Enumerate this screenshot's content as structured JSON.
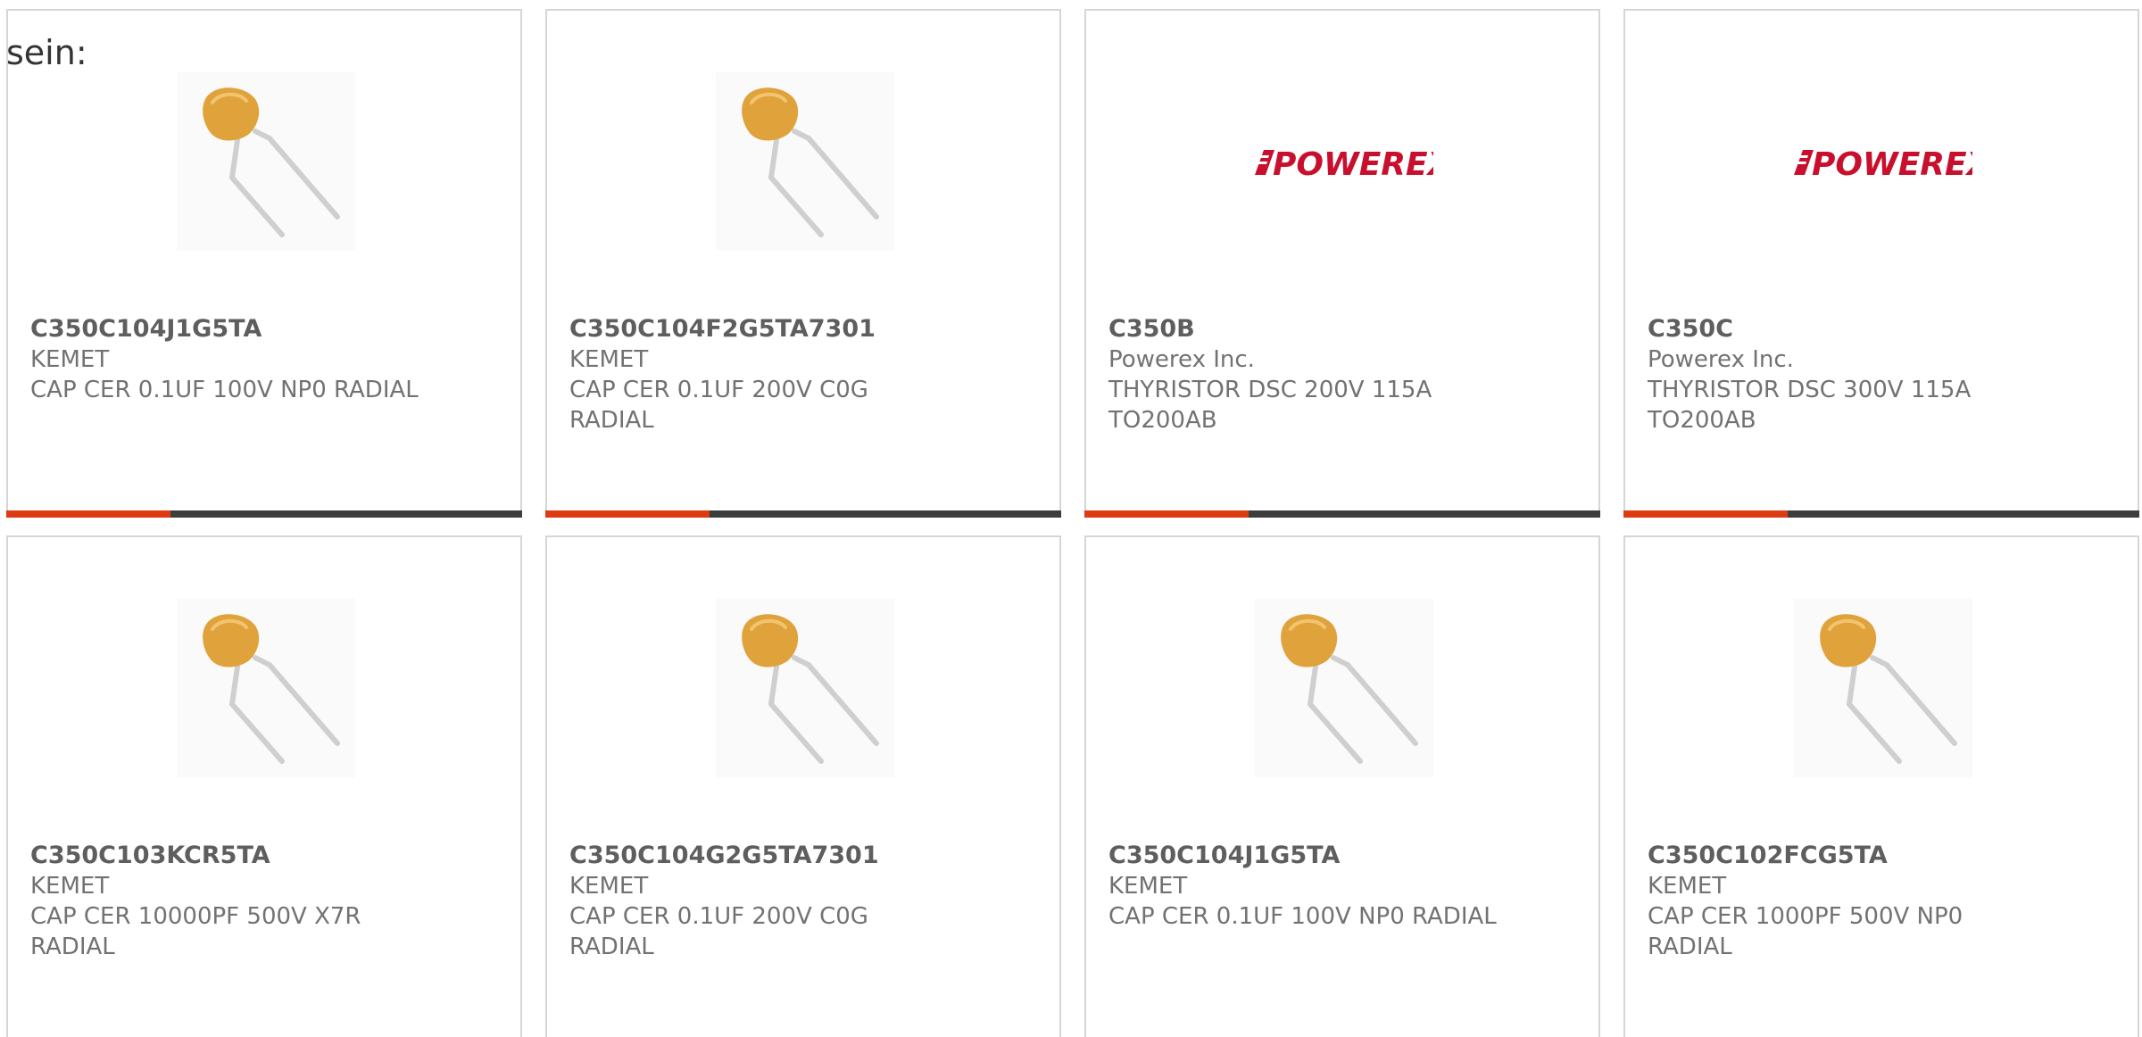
{
  "intro": {
    "text": "sein:"
  },
  "colors": {
    "accent": "#de3a13",
    "bar": "#3d3d3d",
    "border": "#d6d6d6",
    "text": "#727272",
    "logo": "#c8102e",
    "capacitor": "#e0a33c"
  },
  "cards": [
    {
      "part": "C350C104J1G5TA",
      "manufacturer": "KEMET",
      "description": "CAP CER 0.1UF 100V NP0 RADIAL",
      "image": "capacitor-image"
    },
    {
      "part": "C350C104F2G5TA7301",
      "manufacturer": "KEMET",
      "description": "CAP CER 0.1UF 200V C0G\nRADIAL",
      "image": "capacitor-image"
    },
    {
      "part": "C350B",
      "manufacturer": "Powerex Inc.",
      "description": "THYRISTOR DSC 200V 115A\nTO200AB",
      "image": "powerex-logo",
      "logo_text": "POWEREX"
    },
    {
      "part": "C350C",
      "manufacturer": "Powerex Inc.",
      "description": "THYRISTOR DSC 300V 115A\nTO200AB",
      "image": "powerex-logo",
      "logo_text": "POWEREX"
    },
    {
      "part": "C350C103KCR5TA",
      "manufacturer": "KEMET",
      "description": "CAP CER 10000PF 500V X7R\nRADIAL",
      "image": "capacitor-image"
    },
    {
      "part": "C350C104G2G5TA7301",
      "manufacturer": "KEMET",
      "description": "CAP CER 0.1UF 200V C0G\nRADIAL",
      "image": "capacitor-image"
    },
    {
      "part": "C350C104J1G5TA",
      "manufacturer": "KEMET",
      "description": "CAP CER 0.1UF 100V NP0 RADIAL",
      "image": "capacitor-image"
    },
    {
      "part": "C350C102FCG5TA",
      "manufacturer": "KEMET",
      "description": "CAP CER 1000PF 500V NP0\nRADIAL",
      "image": "capacitor-image"
    }
  ]
}
